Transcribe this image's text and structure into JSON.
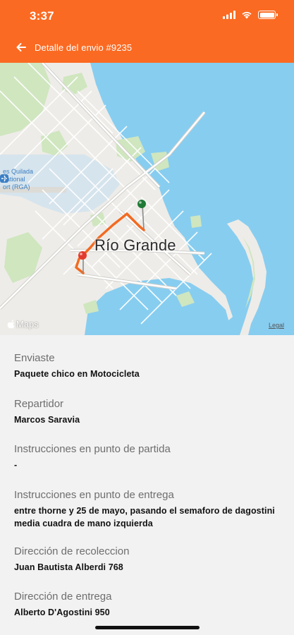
{
  "status_bar": {
    "time": "3:37"
  },
  "header": {
    "title": "Detalle del envio #9235"
  },
  "map": {
    "city_label": "Río Grande",
    "airport_label_lines": [
      "es Quilada",
      "national",
      "ort (RGA)"
    ],
    "attribution": "Maps",
    "legal": "Legal",
    "colors": {
      "water": "#87cdf0",
      "land": "#eeece8",
      "park": "#cfe6bf",
      "route": "#f26a21",
      "origin_pin": "#1f7a36",
      "destination_pin": "#e23b2e"
    }
  },
  "details": [
    {
      "label": "Enviaste",
      "value": "Paquete chico en Motocicleta"
    },
    {
      "label": "Repartidor",
      "value": "Marcos Saravia"
    },
    {
      "label": "Instrucciones en punto de partida",
      "value": "-"
    },
    {
      "label": "Instrucciones en punto de entrega",
      "value": "entre thorne y 25 de mayo, pasando el semaforo de dagostini media cuadra de mano izquierda"
    },
    {
      "label": "Dirección de recoleccion",
      "value": "Juan Bautista Alberdi 768"
    },
    {
      "label": "Dirección de entrega",
      "value": "Alberto D'Agostini 950"
    }
  ]
}
